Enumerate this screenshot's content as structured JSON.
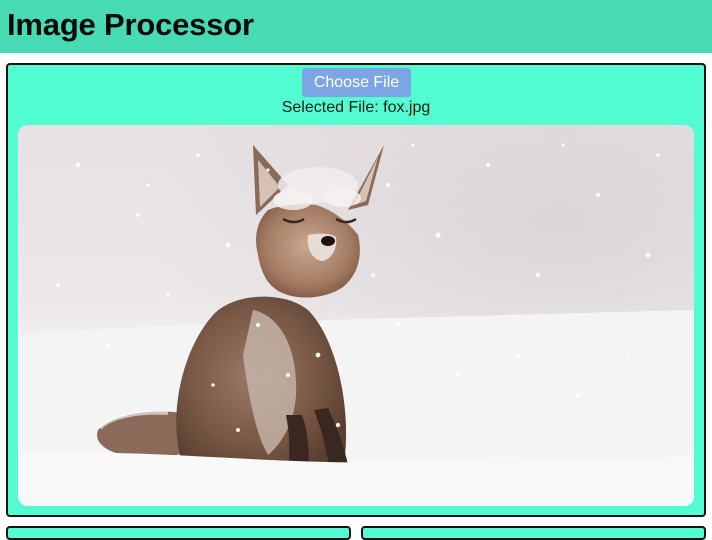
{
  "header": {
    "title": "Image Processor"
  },
  "uploader": {
    "choose_file_label": "Choose File",
    "selected_file_text": "Selected File: fox.jpg"
  },
  "preview": {
    "subject": "red fox sitting in snowfall"
  },
  "colors": {
    "header_bg": "#47dbb5",
    "panel_bg": "#52fdd1",
    "button_bg": "#7ba6e3",
    "panel_border": "#111111"
  }
}
